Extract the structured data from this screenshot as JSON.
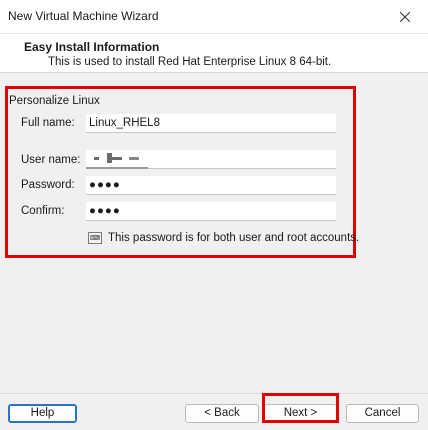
{
  "window": {
    "title": "New Virtual Machine Wizard"
  },
  "header": {
    "title": "Easy Install Information",
    "subtitle": "This is used to install Red Hat Enterprise Linux 8 64-bit."
  },
  "group": {
    "label": "Personalize Linux"
  },
  "form": {
    "full_name_label": "Full name:",
    "full_name_value": "Linux_RHEL8",
    "user_name_label": "User name:",
    "password_label": "Password:",
    "password_mask": "●●●●",
    "confirm_label": "Confirm:",
    "confirm_mask": "●●●●"
  },
  "info": {
    "text": "This password is for both user and root accounts."
  },
  "buttons": {
    "help": "Help",
    "back": "< Back",
    "next": "Next >",
    "cancel": "Cancel"
  },
  "colors": {
    "highlight": "#e00000",
    "focus": "#2a74c7"
  },
  "icons": {
    "close": "close-icon",
    "info": "keyboard-info-icon"
  }
}
